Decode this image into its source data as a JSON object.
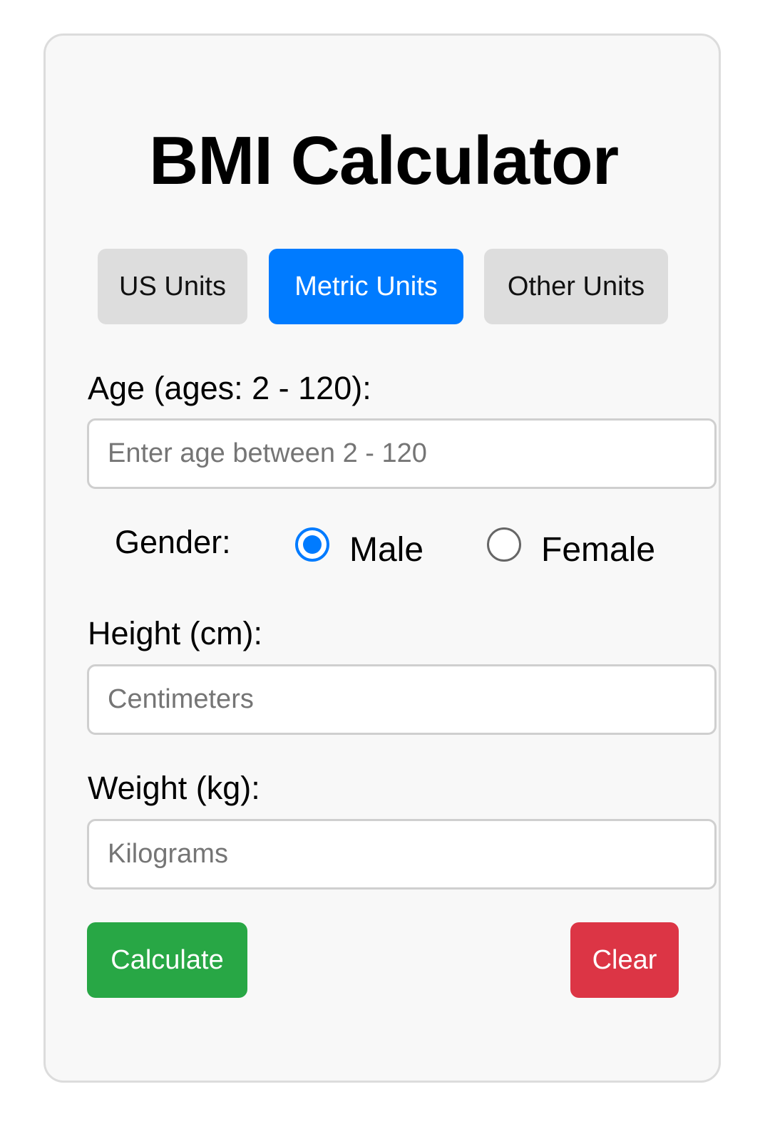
{
  "title": "BMI Calculator",
  "tabs": [
    {
      "label": "US Units",
      "active": false
    },
    {
      "label": "Metric Units",
      "active": true
    },
    {
      "label": "Other Units",
      "active": false
    }
  ],
  "age": {
    "label": "Age (ages: 2 - 120):",
    "placeholder": "Enter age between 2 - 120",
    "value": ""
  },
  "gender": {
    "label": "Gender:",
    "options": [
      {
        "label": "Male",
        "checked": true
      },
      {
        "label": "Female",
        "checked": false
      }
    ]
  },
  "height": {
    "label": "Height (cm):",
    "placeholder": "Centimeters",
    "value": ""
  },
  "weight": {
    "label": "Weight (kg):",
    "placeholder": "Kilograms",
    "value": ""
  },
  "actions": {
    "calculate_label": "Calculate",
    "clear_label": "Clear"
  },
  "colors": {
    "accent": "#007bff",
    "calculate": "#28a745",
    "clear": "#dc3545",
    "tab_inactive": "#dddddd",
    "card_background": "#f8f8f8"
  }
}
